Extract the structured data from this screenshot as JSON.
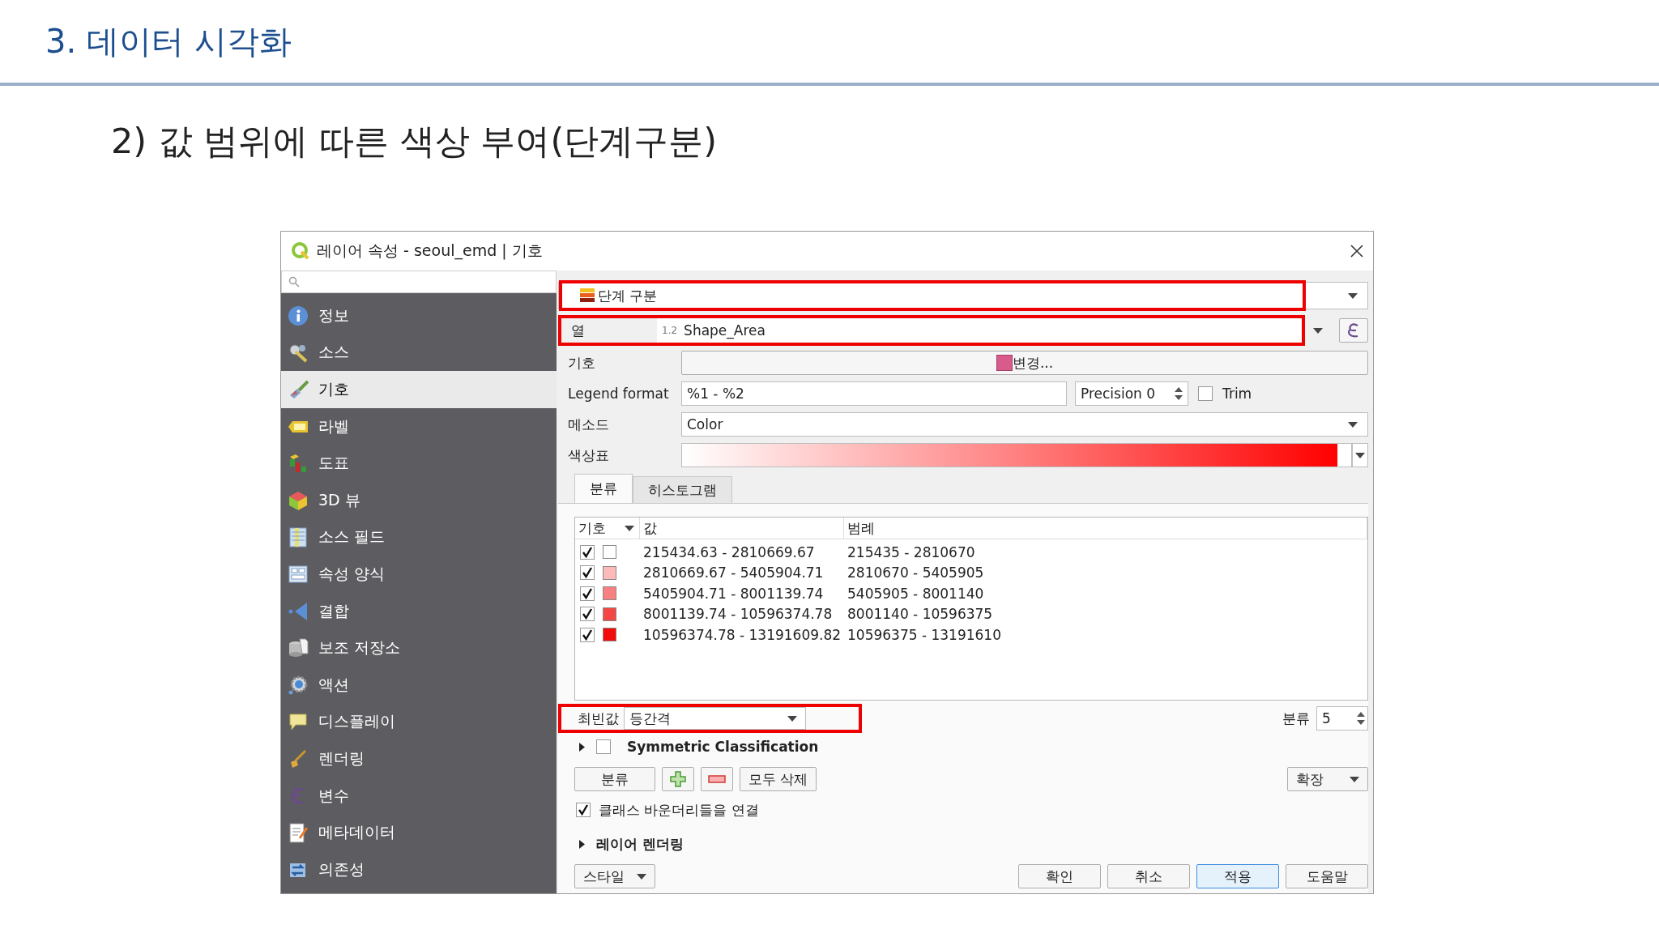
{
  "slide": {
    "heading": "3. 데이터 시각화",
    "subtitle": "2) 값 범위에 따른 색상 부여(단계구분)"
  },
  "dialog": {
    "title": "레이어 속성 - seoul_emd | 기호",
    "sidebar": {
      "items": [
        {
          "label": "정보",
          "selected": false
        },
        {
          "label": "소스",
          "selected": false
        },
        {
          "label": "기호",
          "selected": true
        },
        {
          "label": "라벨",
          "selected": false
        },
        {
          "label": "도표",
          "selected": false
        },
        {
          "label": "3D 뷰",
          "selected": false
        },
        {
          "label": "소스 필드",
          "selected": false
        },
        {
          "label": "속성 양식",
          "selected": false
        },
        {
          "label": "결합",
          "selected": false
        },
        {
          "label": "보조 저장소",
          "selected": false
        },
        {
          "label": "액션",
          "selected": false
        },
        {
          "label": "디스플레이",
          "selected": false
        },
        {
          "label": "렌더링",
          "selected": false
        },
        {
          "label": "변수",
          "selected": false
        },
        {
          "label": "메타데이터",
          "selected": false
        },
        {
          "label": "의존성",
          "selected": false
        }
      ]
    },
    "renderer": {
      "value": "단계 구분",
      "highlighted": true
    },
    "column": {
      "label": "열",
      "type_badge": "1.2",
      "value": "Shape_Area",
      "highlighted": true
    },
    "symbol": {
      "label": "기호",
      "button": "변경..."
    },
    "legend_format": {
      "label": "Legend format",
      "value": "%1 - %2",
      "precision": "Precision 0",
      "trim": {
        "label": "Trim",
        "checked": false
      }
    },
    "method": {
      "label": "메소드",
      "value": "Color"
    },
    "color_ramp": {
      "label": "색상표"
    },
    "tabs": [
      {
        "label": "분류",
        "selected": true
      },
      {
        "label": "히스토그램",
        "selected": false
      }
    ],
    "table": {
      "columns": [
        "기호",
        "값",
        "범례"
      ],
      "rows": [
        {
          "checked": true,
          "color": "#ffffff",
          "value": "215434.63 - 2810669.67",
          "legend": "215435 - 2810670"
        },
        {
          "checked": true,
          "color": "#fcbaba",
          "value": "2810669.67 - 5405904.71",
          "legend": "2810670 - 5405905"
        },
        {
          "checked": true,
          "color": "#f98080",
          "value": "5405904.71 - 8001139.74",
          "legend": "5405905 - 8001140"
        },
        {
          "checked": true,
          "color": "#f54646",
          "value": "8001139.74 - 10596374.78",
          "legend": "8001140 - 10596375"
        },
        {
          "checked": true,
          "color": "#f20c0c",
          "value": "10596374.78 - 13191609.82",
          "legend": "10596375 - 13191610"
        }
      ]
    },
    "mode": {
      "label": "최빈값",
      "value": "등간격",
      "highlighted": true
    },
    "classes": {
      "label": "분류",
      "value": "5"
    },
    "symmetric": {
      "label": "Symmetric Classification",
      "checked": false,
      "expanded": false
    },
    "actions": {
      "classify": "분류",
      "delete_all": "모두 삭제",
      "advanced": "확장"
    },
    "link_boundaries": {
      "label": "클래스 바운더리들을 연결",
      "checked": true
    },
    "layer_rendering": {
      "label": "레이어 렌더링",
      "expanded": false
    },
    "style_button": "스타일",
    "footer_buttons": [
      {
        "label": "확인",
        "selected": false
      },
      {
        "label": "취소",
        "selected": false
      },
      {
        "label": "적용",
        "selected": true
      },
      {
        "label": "도움말",
        "selected": false
      }
    ]
  }
}
